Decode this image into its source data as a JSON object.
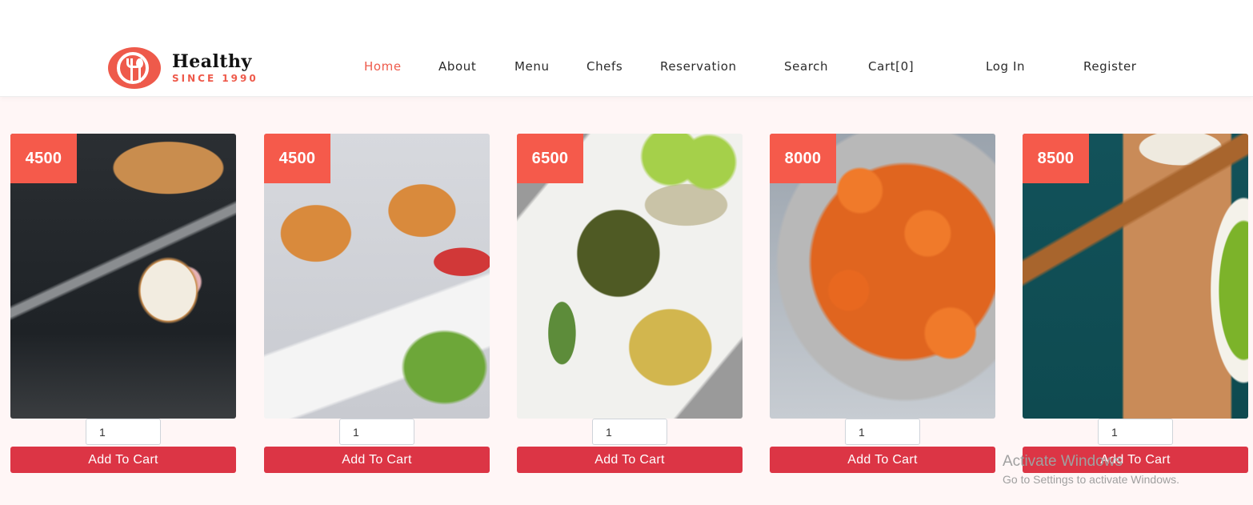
{
  "brand": {
    "title": "Healthy",
    "subtitle": "SINCE 1990",
    "accent_color": "#ee5a4b"
  },
  "nav": {
    "items": [
      {
        "label": "Home",
        "active": true
      },
      {
        "label": "About"
      },
      {
        "label": "Menu"
      },
      {
        "label": "Chefs"
      },
      {
        "label": "Reservation"
      },
      {
        "label": "Search"
      },
      {
        "label": "Cart[0]"
      },
      {
        "label": "Log In"
      },
      {
        "label": "Register"
      }
    ]
  },
  "products": [
    {
      "price": "4500",
      "qty": "1",
      "add_label": "Add To Cart",
      "image": "bread-with-spread-photo"
    },
    {
      "price": "4500",
      "qty": "1",
      "add_label": "Add To Cart",
      "image": "onions-lettuce-wraps-photo"
    },
    {
      "price": "6500",
      "qty": "1",
      "add_label": "Add To Cart",
      "image": "green-beans-potato-salad-photo"
    },
    {
      "price": "8000",
      "qty": "1",
      "add_label": "Add To Cart",
      "image": "roasted-carrots-photo"
    },
    {
      "price": "8500",
      "qty": "1",
      "add_label": "Add To Cart",
      "image": "roasted-sweet-potato-photo"
    }
  ],
  "colors": {
    "price_badge": "#f55a4b",
    "add_button": "#dc3545",
    "page_bg": "#fff6f6"
  },
  "watermark": {
    "line1": "Activate Windows",
    "line2": "Go to Settings to activate Windows."
  }
}
